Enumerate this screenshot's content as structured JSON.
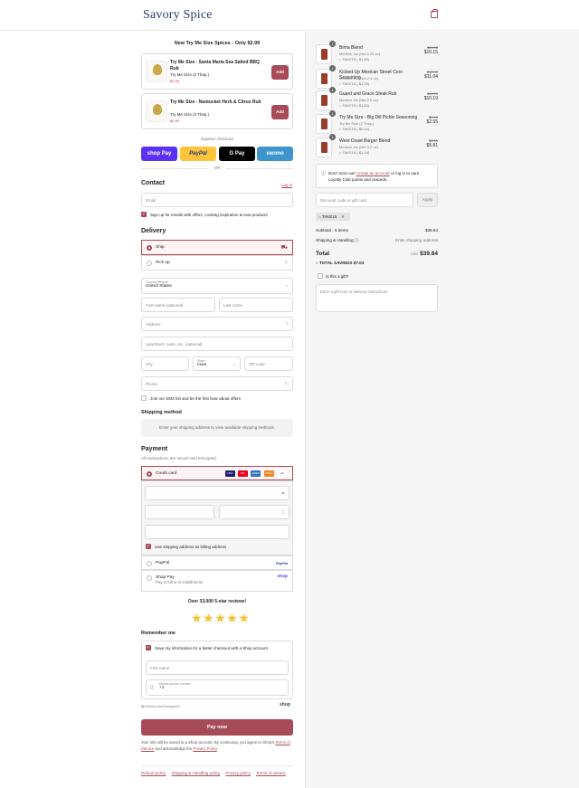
{
  "header": {
    "brand": "Savory Spice"
  },
  "upsell": {
    "title": "New Try Me Size Spices - Only $2.99",
    "items": [
      {
        "name": "Try Me Size - Santa Maria Sea Salted BBQ Rub",
        "size": "Try Me Size (2 Tbsp.)",
        "price": "$2.99",
        "button": "Add"
      },
      {
        "name": "Try Me Size - Nantucket Herb & Citrus Rub",
        "size": "Try Me Size (2 Tbsp.)",
        "price": "$2.99",
        "button": "Add"
      }
    ]
  },
  "express": {
    "label": "Express checkout",
    "buttons": [
      "shop Pay",
      "PayPal",
      "G Pay",
      "venmo"
    ],
    "or": "OR"
  },
  "contact": {
    "title": "Contact",
    "login": "Log in",
    "email_placeholder": "Email",
    "signup": "Sign up for emails with offers, cooking inspiration & new products"
  },
  "delivery": {
    "title": "Delivery",
    "ship": "Ship",
    "pickup": "Pick up",
    "country_label": "Country/Region",
    "country": "United States",
    "first_name": "First name (optional)",
    "last_name": "Last name",
    "address": "Address",
    "apartment": "Apartment, suite, etc. (optional)",
    "city": "City",
    "state_label": "State",
    "state": "Iowa",
    "zip": "ZIP code",
    "phone": "Phone",
    "sms": "Join our SMS list and be the first hear about offers"
  },
  "shipping": {
    "title": "Shipping method",
    "notice": "Enter your shipping address to view available shipping methods."
  },
  "payment": {
    "title": "Payment",
    "subtitle": "All transactions are secure and encrypted.",
    "credit_card": "Credit card",
    "billing": "Use shipping address as billing address",
    "paypal": "PayPal",
    "shoppay": "Shop Pay",
    "shoppay_sub": "Pay in full or in installments",
    "card_logos": [
      "VISA",
      "MC",
      "AMEX",
      "DISC",
      "+8"
    ],
    "paypal_logo": "PayPal",
    "shop_logo": "shop"
  },
  "reviews": {
    "text": "Over 33,000 5-star reviews!",
    "stars": "★★★★★"
  },
  "remember": {
    "title": "Remember me",
    "save": "Save my information for a faster checkout with a Shop account",
    "first_name": "First name",
    "mobile_label": "Mobile phone number",
    "mobile_value": "+1",
    "secure": "Secure and encrypted",
    "shop": "shop"
  },
  "pay_now": "Pay now",
  "legal": {
    "line1": "Your info will be saved to a Shop account. By continuing, you agree to Shop's",
    "terms": "Terms of Service",
    "middle": "and acknowledge the",
    "privacy": "Privacy Policy",
    "end": "."
  },
  "footer": [
    "Refund policy",
    "Shipping & Handling policy",
    "Privacy policy",
    "Terms of service"
  ],
  "order": {
    "items": [
      {
        "qty": "1",
        "name": "Birria Blend",
        "size": "Medium Jar (Net 2.25 oz)",
        "code": "TAKE15 (-$1.80)",
        "old_price": "$11.95",
        "price": "$10.15"
      },
      {
        "qty": "1",
        "name": "Kicked-Up Mexican Street Corn Seasoning",
        "size": "Medium Jar (Net 2.4 oz)",
        "code": "TAKE15 (-$1.95)",
        "old_price": "$12.99",
        "price": "$11.04"
      },
      {
        "qty": "1",
        "name": "Guard and Grace Steak Rub",
        "size": "Medium Jar (Net 2.6 oz)",
        "code": "TAKE15 (-$1.80)",
        "old_price": "$11.99",
        "price": "$10.19"
      },
      {
        "qty": "1",
        "name": "Try Me Size - Big Dill Pickle Seasoning",
        "size": "Try Me Size (2 Tbsp.)",
        "code": "TAKE15 (-$0.44)",
        "old_price": "$2.99",
        "price": "$2.55"
      },
      {
        "qty": "1",
        "name": "West Coast Burger Blend",
        "size": "Medium Jar (Net 3.2 oz)",
        "code": "TAKE15 (-$1.04)",
        "old_price": "$6.95",
        "price": "$5.81"
      }
    ],
    "loyalty_pre": "Don't miss out!",
    "loyalty_link": "Create an account",
    "loyalty_post": "or log in to earn Loyalty Club points and rewards.",
    "discount_placeholder": "Discount code or gift card",
    "apply": "Apply",
    "tag": "TAKE15",
    "subtotal_label": "Subtotal · 5 items",
    "subtotal": "$39.84",
    "shipping_label": "Shipping & Handling",
    "shipping": "Enter shipping address",
    "total_label": "Total",
    "currency": "USD",
    "total": "$39.84",
    "savings_label": "TOTAL SAVINGS",
    "savings": "$7.03",
    "gift_label": "Is this a gift?",
    "gift_placeholder": "Enter a gift note or delivery instructions"
  }
}
